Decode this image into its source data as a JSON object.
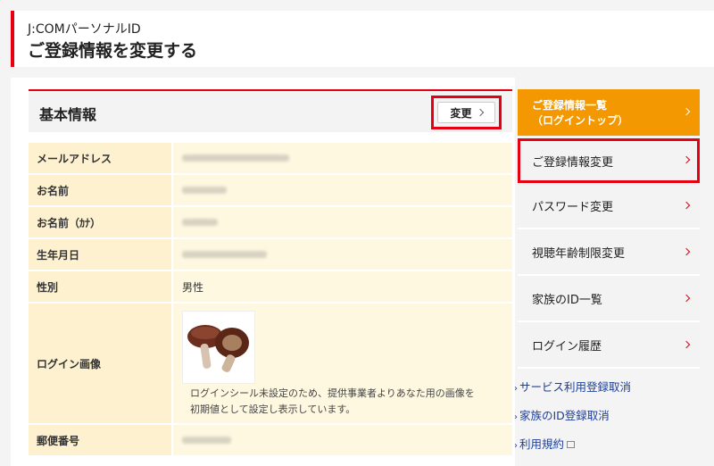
{
  "header": {
    "subtitle": "J:COMパーソナルID",
    "title": "ご登録情報を変更する"
  },
  "section": {
    "title": "基本情報",
    "edit_label": "変更"
  },
  "info_rows": {
    "email_label": "メールアドレス",
    "name_label": "お名前",
    "name_kana_label": "お名前（ｶﾅ）",
    "birthdate_label": "生年月日",
    "gender_label": "性別",
    "gender_value": "男性",
    "login_image_label": "ログイン画像",
    "login_image_note": "ログインシール未設定のため、提供事業者よりあなた用の画像を初期値として設定し表示しています。",
    "postal_label": "郵便番号"
  },
  "sidebar": {
    "top_line1": "ご登録情報一覧",
    "top_line2": "（ログイントップ）",
    "items": [
      {
        "label": "ご登録情報変更"
      },
      {
        "label": "パスワード変更"
      },
      {
        "label": "視聴年齢制限変更"
      },
      {
        "label": "家族のID一覧"
      },
      {
        "label": "ログイン履歴"
      }
    ]
  },
  "links": [
    {
      "label": "サービス利用登録取消"
    },
    {
      "label": "家族のID登録取消"
    },
    {
      "label": "利用規約"
    }
  ],
  "colors": {
    "accent_red": "#e60012",
    "orange": "#f39800",
    "link_blue": "#1d3f9a"
  }
}
